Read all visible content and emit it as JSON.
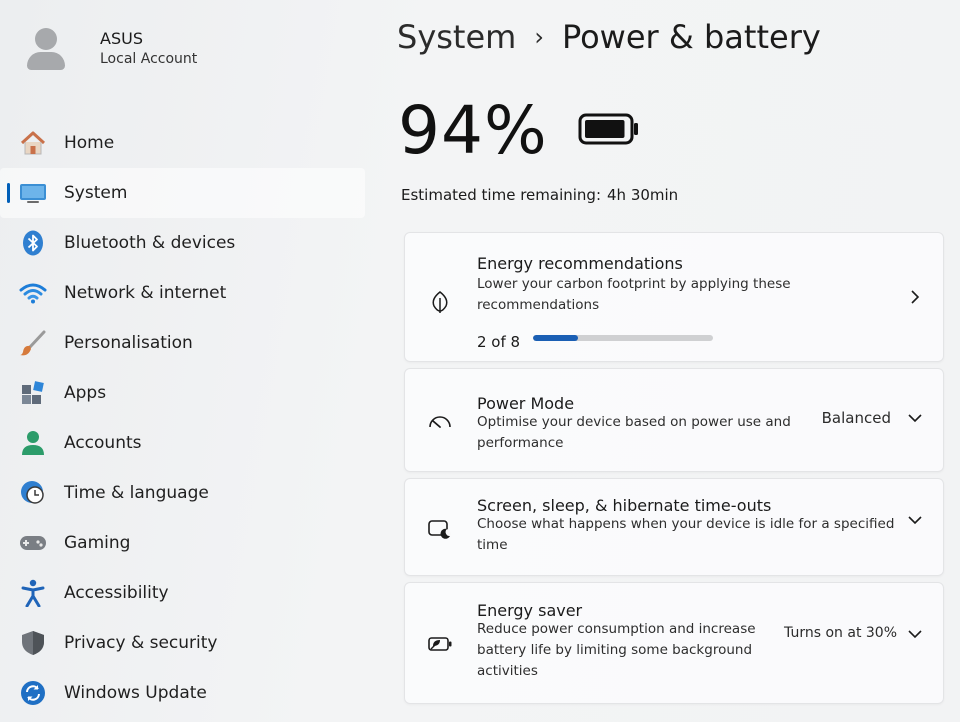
{
  "profile": {
    "name": "ASUS",
    "account_type": "Local Account"
  },
  "sidebar": {
    "items": [
      {
        "label": "Home",
        "icon": "home-icon"
      },
      {
        "label": "System",
        "icon": "system-icon",
        "selected": true
      },
      {
        "label": "Bluetooth & devices",
        "icon": "bluetooth-icon"
      },
      {
        "label": "Network & internet",
        "icon": "wifi-icon"
      },
      {
        "label": "Personalisation",
        "icon": "brush-icon"
      },
      {
        "label": "Apps",
        "icon": "apps-icon"
      },
      {
        "label": "Accounts",
        "icon": "account-icon"
      },
      {
        "label": "Time & language",
        "icon": "clock-globe-icon"
      },
      {
        "label": "Gaming",
        "icon": "gamepad-icon"
      },
      {
        "label": "Accessibility",
        "icon": "accessibility-icon"
      },
      {
        "label": "Privacy & security",
        "icon": "shield-icon"
      },
      {
        "label": "Windows Update",
        "icon": "update-icon"
      }
    ]
  },
  "breadcrumb": {
    "parent": "System",
    "separator": "›",
    "current": "Power & battery"
  },
  "battery": {
    "percent_label": "94%",
    "percent": 94,
    "estimated_label": "Estimated time remaining:",
    "estimated_value": "4h 30min"
  },
  "cards": {
    "energy_recommendations": {
      "title": "Energy recommendations",
      "description": "Lower your carbon footprint by applying these recommendations",
      "progress_label": "2 of 8",
      "progress_fraction": 0.25,
      "icon": "leaf-icon"
    },
    "power_mode": {
      "title": "Power Mode",
      "description": "Optimise your device based on power use and performance",
      "value": "Balanced",
      "icon": "gauge-icon"
    },
    "screen_sleep": {
      "title": "Screen, sleep, & hibernate time-outs",
      "description": "Choose what happens when your device is idle for a specified time",
      "icon": "screen-sleep-icon"
    },
    "energy_saver": {
      "title": "Energy saver",
      "description": "Reduce power consumption and increase battery life by limiting some background activities",
      "value": "Turns on at 30%",
      "icon": "battery-saver-icon"
    }
  },
  "colors": {
    "accent": "#005fb8",
    "progress": "#1a5fb4"
  }
}
